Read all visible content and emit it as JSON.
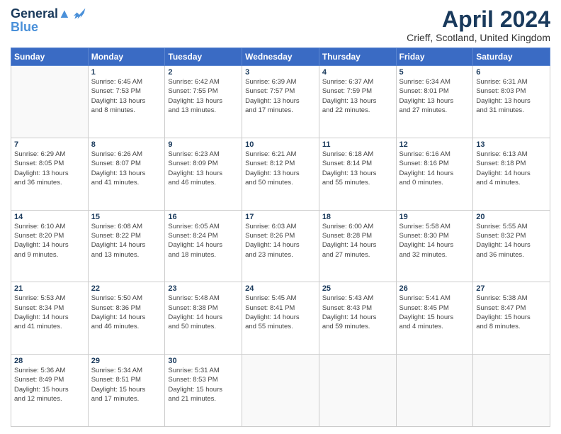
{
  "header": {
    "logo_line1": "General",
    "logo_line2": "Blue",
    "title": "April 2024",
    "subtitle": "Crieff, Scotland, United Kingdom"
  },
  "days_of_week": [
    "Sunday",
    "Monday",
    "Tuesday",
    "Wednesday",
    "Thursday",
    "Friday",
    "Saturday"
  ],
  "weeks": [
    [
      {
        "day": "",
        "info": ""
      },
      {
        "day": "1",
        "info": "Sunrise: 6:45 AM\nSunset: 7:53 PM\nDaylight: 13 hours\nand 8 minutes."
      },
      {
        "day": "2",
        "info": "Sunrise: 6:42 AM\nSunset: 7:55 PM\nDaylight: 13 hours\nand 13 minutes."
      },
      {
        "day": "3",
        "info": "Sunrise: 6:39 AM\nSunset: 7:57 PM\nDaylight: 13 hours\nand 17 minutes."
      },
      {
        "day": "4",
        "info": "Sunrise: 6:37 AM\nSunset: 7:59 PM\nDaylight: 13 hours\nand 22 minutes."
      },
      {
        "day": "5",
        "info": "Sunrise: 6:34 AM\nSunset: 8:01 PM\nDaylight: 13 hours\nand 27 minutes."
      },
      {
        "day": "6",
        "info": "Sunrise: 6:31 AM\nSunset: 8:03 PM\nDaylight: 13 hours\nand 31 minutes."
      }
    ],
    [
      {
        "day": "7",
        "info": "Sunrise: 6:29 AM\nSunset: 8:05 PM\nDaylight: 13 hours\nand 36 minutes."
      },
      {
        "day": "8",
        "info": "Sunrise: 6:26 AM\nSunset: 8:07 PM\nDaylight: 13 hours\nand 41 minutes."
      },
      {
        "day": "9",
        "info": "Sunrise: 6:23 AM\nSunset: 8:09 PM\nDaylight: 13 hours\nand 46 minutes."
      },
      {
        "day": "10",
        "info": "Sunrise: 6:21 AM\nSunset: 8:12 PM\nDaylight: 13 hours\nand 50 minutes."
      },
      {
        "day": "11",
        "info": "Sunrise: 6:18 AM\nSunset: 8:14 PM\nDaylight: 13 hours\nand 55 minutes."
      },
      {
        "day": "12",
        "info": "Sunrise: 6:16 AM\nSunset: 8:16 PM\nDaylight: 14 hours\nand 0 minutes."
      },
      {
        "day": "13",
        "info": "Sunrise: 6:13 AM\nSunset: 8:18 PM\nDaylight: 14 hours\nand 4 minutes."
      }
    ],
    [
      {
        "day": "14",
        "info": "Sunrise: 6:10 AM\nSunset: 8:20 PM\nDaylight: 14 hours\nand 9 minutes."
      },
      {
        "day": "15",
        "info": "Sunrise: 6:08 AM\nSunset: 8:22 PM\nDaylight: 14 hours\nand 13 minutes."
      },
      {
        "day": "16",
        "info": "Sunrise: 6:05 AM\nSunset: 8:24 PM\nDaylight: 14 hours\nand 18 minutes."
      },
      {
        "day": "17",
        "info": "Sunrise: 6:03 AM\nSunset: 8:26 PM\nDaylight: 14 hours\nand 23 minutes."
      },
      {
        "day": "18",
        "info": "Sunrise: 6:00 AM\nSunset: 8:28 PM\nDaylight: 14 hours\nand 27 minutes."
      },
      {
        "day": "19",
        "info": "Sunrise: 5:58 AM\nSunset: 8:30 PM\nDaylight: 14 hours\nand 32 minutes."
      },
      {
        "day": "20",
        "info": "Sunrise: 5:55 AM\nSunset: 8:32 PM\nDaylight: 14 hours\nand 36 minutes."
      }
    ],
    [
      {
        "day": "21",
        "info": "Sunrise: 5:53 AM\nSunset: 8:34 PM\nDaylight: 14 hours\nand 41 minutes."
      },
      {
        "day": "22",
        "info": "Sunrise: 5:50 AM\nSunset: 8:36 PM\nDaylight: 14 hours\nand 46 minutes."
      },
      {
        "day": "23",
        "info": "Sunrise: 5:48 AM\nSunset: 8:38 PM\nDaylight: 14 hours\nand 50 minutes."
      },
      {
        "day": "24",
        "info": "Sunrise: 5:45 AM\nSunset: 8:41 PM\nDaylight: 14 hours\nand 55 minutes."
      },
      {
        "day": "25",
        "info": "Sunrise: 5:43 AM\nSunset: 8:43 PM\nDaylight: 14 hours\nand 59 minutes."
      },
      {
        "day": "26",
        "info": "Sunrise: 5:41 AM\nSunset: 8:45 PM\nDaylight: 15 hours\nand 4 minutes."
      },
      {
        "day": "27",
        "info": "Sunrise: 5:38 AM\nSunset: 8:47 PM\nDaylight: 15 hours\nand 8 minutes."
      }
    ],
    [
      {
        "day": "28",
        "info": "Sunrise: 5:36 AM\nSunset: 8:49 PM\nDaylight: 15 hours\nand 12 minutes."
      },
      {
        "day": "29",
        "info": "Sunrise: 5:34 AM\nSunset: 8:51 PM\nDaylight: 15 hours\nand 17 minutes."
      },
      {
        "day": "30",
        "info": "Sunrise: 5:31 AM\nSunset: 8:53 PM\nDaylight: 15 hours\nand 21 minutes."
      },
      {
        "day": "",
        "info": ""
      },
      {
        "day": "",
        "info": ""
      },
      {
        "day": "",
        "info": ""
      },
      {
        "day": "",
        "info": ""
      }
    ]
  ]
}
